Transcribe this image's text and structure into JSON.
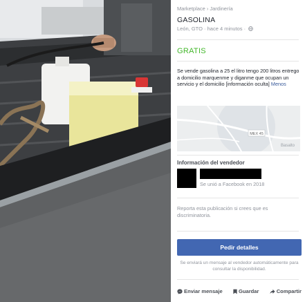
{
  "breadcrumb": {
    "root": "Marketplace",
    "separator": "›",
    "category": "Jardinería"
  },
  "listing": {
    "title": "GASOLINA",
    "meta": "León, GTO · hace 4 minutos ·",
    "price": "GRATIS",
    "description": "Se vende gasolina a 25 el litro tengo 200 litros entrego a domicilio marquenme y diganme que ocupan un servicio y el domicilio [información oculta]",
    "more_link": "Menos"
  },
  "map": {
    "road_label": "MEX 45",
    "place_label": "Basalto"
  },
  "seller": {
    "section_title": "Información del vendedor",
    "joined": "Se unió a Facebook en 2018"
  },
  "report_text": "Reporta esta publicación si crees que es discriminatoria.",
  "cta": {
    "label": "Pedir detalles",
    "notice": "Se enviará un mensaje al vendedor automáticamente para consultar la disponibilidad."
  },
  "actions": {
    "message": "Enviar mensaje",
    "save": "Guardar",
    "share": "Compartir"
  },
  "icons": {
    "globe": "globe-icon",
    "messenger": "messenger-icon",
    "bookmark": "bookmark-icon",
    "share": "share-arrow-icon"
  },
  "colors": {
    "price_green": "#42b72a",
    "cta_blue": "#4267b2",
    "link_blue": "#365899"
  }
}
